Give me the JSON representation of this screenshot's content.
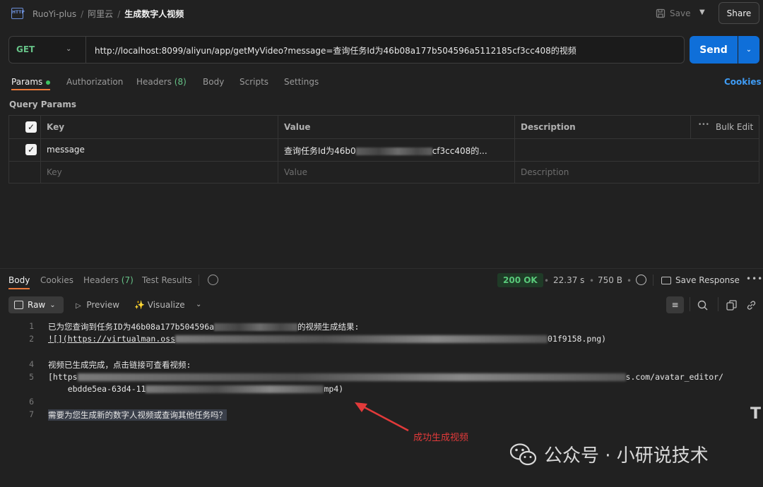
{
  "header": {
    "app_icon_text": "HTTP",
    "breadcrumb": [
      "RuoYi-plus",
      "阿里云",
      "生成数字人视频"
    ],
    "save_label": "Save",
    "share_label": "Share"
  },
  "request": {
    "method": "GET",
    "url": "http://localhost:8099/aliyun/app/getMyVideo?message=查询任务Id为46b08a177b504596a5112185cf3cc408的视频",
    "send_label": "Send"
  },
  "request_tabs": {
    "params": "Params",
    "authorization": "Authorization",
    "headers": "Headers",
    "headers_count": "(8)",
    "body": "Body",
    "scripts": "Scripts",
    "settings": "Settings",
    "cookies": "Cookies"
  },
  "query_params": {
    "title": "Query Params",
    "col_key": "Key",
    "col_value": "Value",
    "col_description": "Description",
    "bulk_edit": "Bulk Edit",
    "more": "•••",
    "row": {
      "key": "message",
      "value_start": "查询任务Id为46b0",
      "value_end": "cf3cc408的...",
      "description": ""
    },
    "placeholder": {
      "key": "Key",
      "value": "Value",
      "description": "Description"
    }
  },
  "response_tabs": {
    "body": "Body",
    "cookies": "Cookies",
    "headers": "Headers",
    "headers_count": "(7)",
    "test_results": "Test Results"
  },
  "response_meta": {
    "status": "200 OK",
    "time": "22.37 s",
    "size": "750 B",
    "save_response": "Save Response",
    "more": "•••"
  },
  "viewer": {
    "raw": "Raw",
    "preview": "Preview",
    "visualize": "Visualize",
    "wrap_icon": "≡"
  },
  "code_lines": [
    {
      "n": "1",
      "a": "已为您查询到任务ID为46b08a177b504596a",
      "b": "的视频生成结果:"
    },
    {
      "n": "2",
      "a": "![](https://virtualman.oss",
      "b": "01f9158.png)"
    },
    {
      "n": "3",
      "a": ""
    },
    {
      "n": "4",
      "a": "视频已生成完成，点击链接可查看视频:"
    },
    {
      "n": "5",
      "a": "[https",
      "b": "s.com/avatar_editor/"
    },
    {
      "n": "",
      "a": "    ebdde5ea-63d4-11",
      "b": "mp4)"
    },
    {
      "n": "6",
      "a": ""
    },
    {
      "n": "7",
      "a": "需要为您生成新的数字人视频或查询其他任务吗？"
    }
  ],
  "annotation": {
    "text": "成功生成视频",
    "color": "#e23a3a"
  },
  "watermark": {
    "text": "公众号 · 小研说技术"
  },
  "colors": {
    "send": "#0f6fd9",
    "method": "#66c287",
    "active_tab": "#e8783a",
    "status_ok": "#59c97a"
  }
}
